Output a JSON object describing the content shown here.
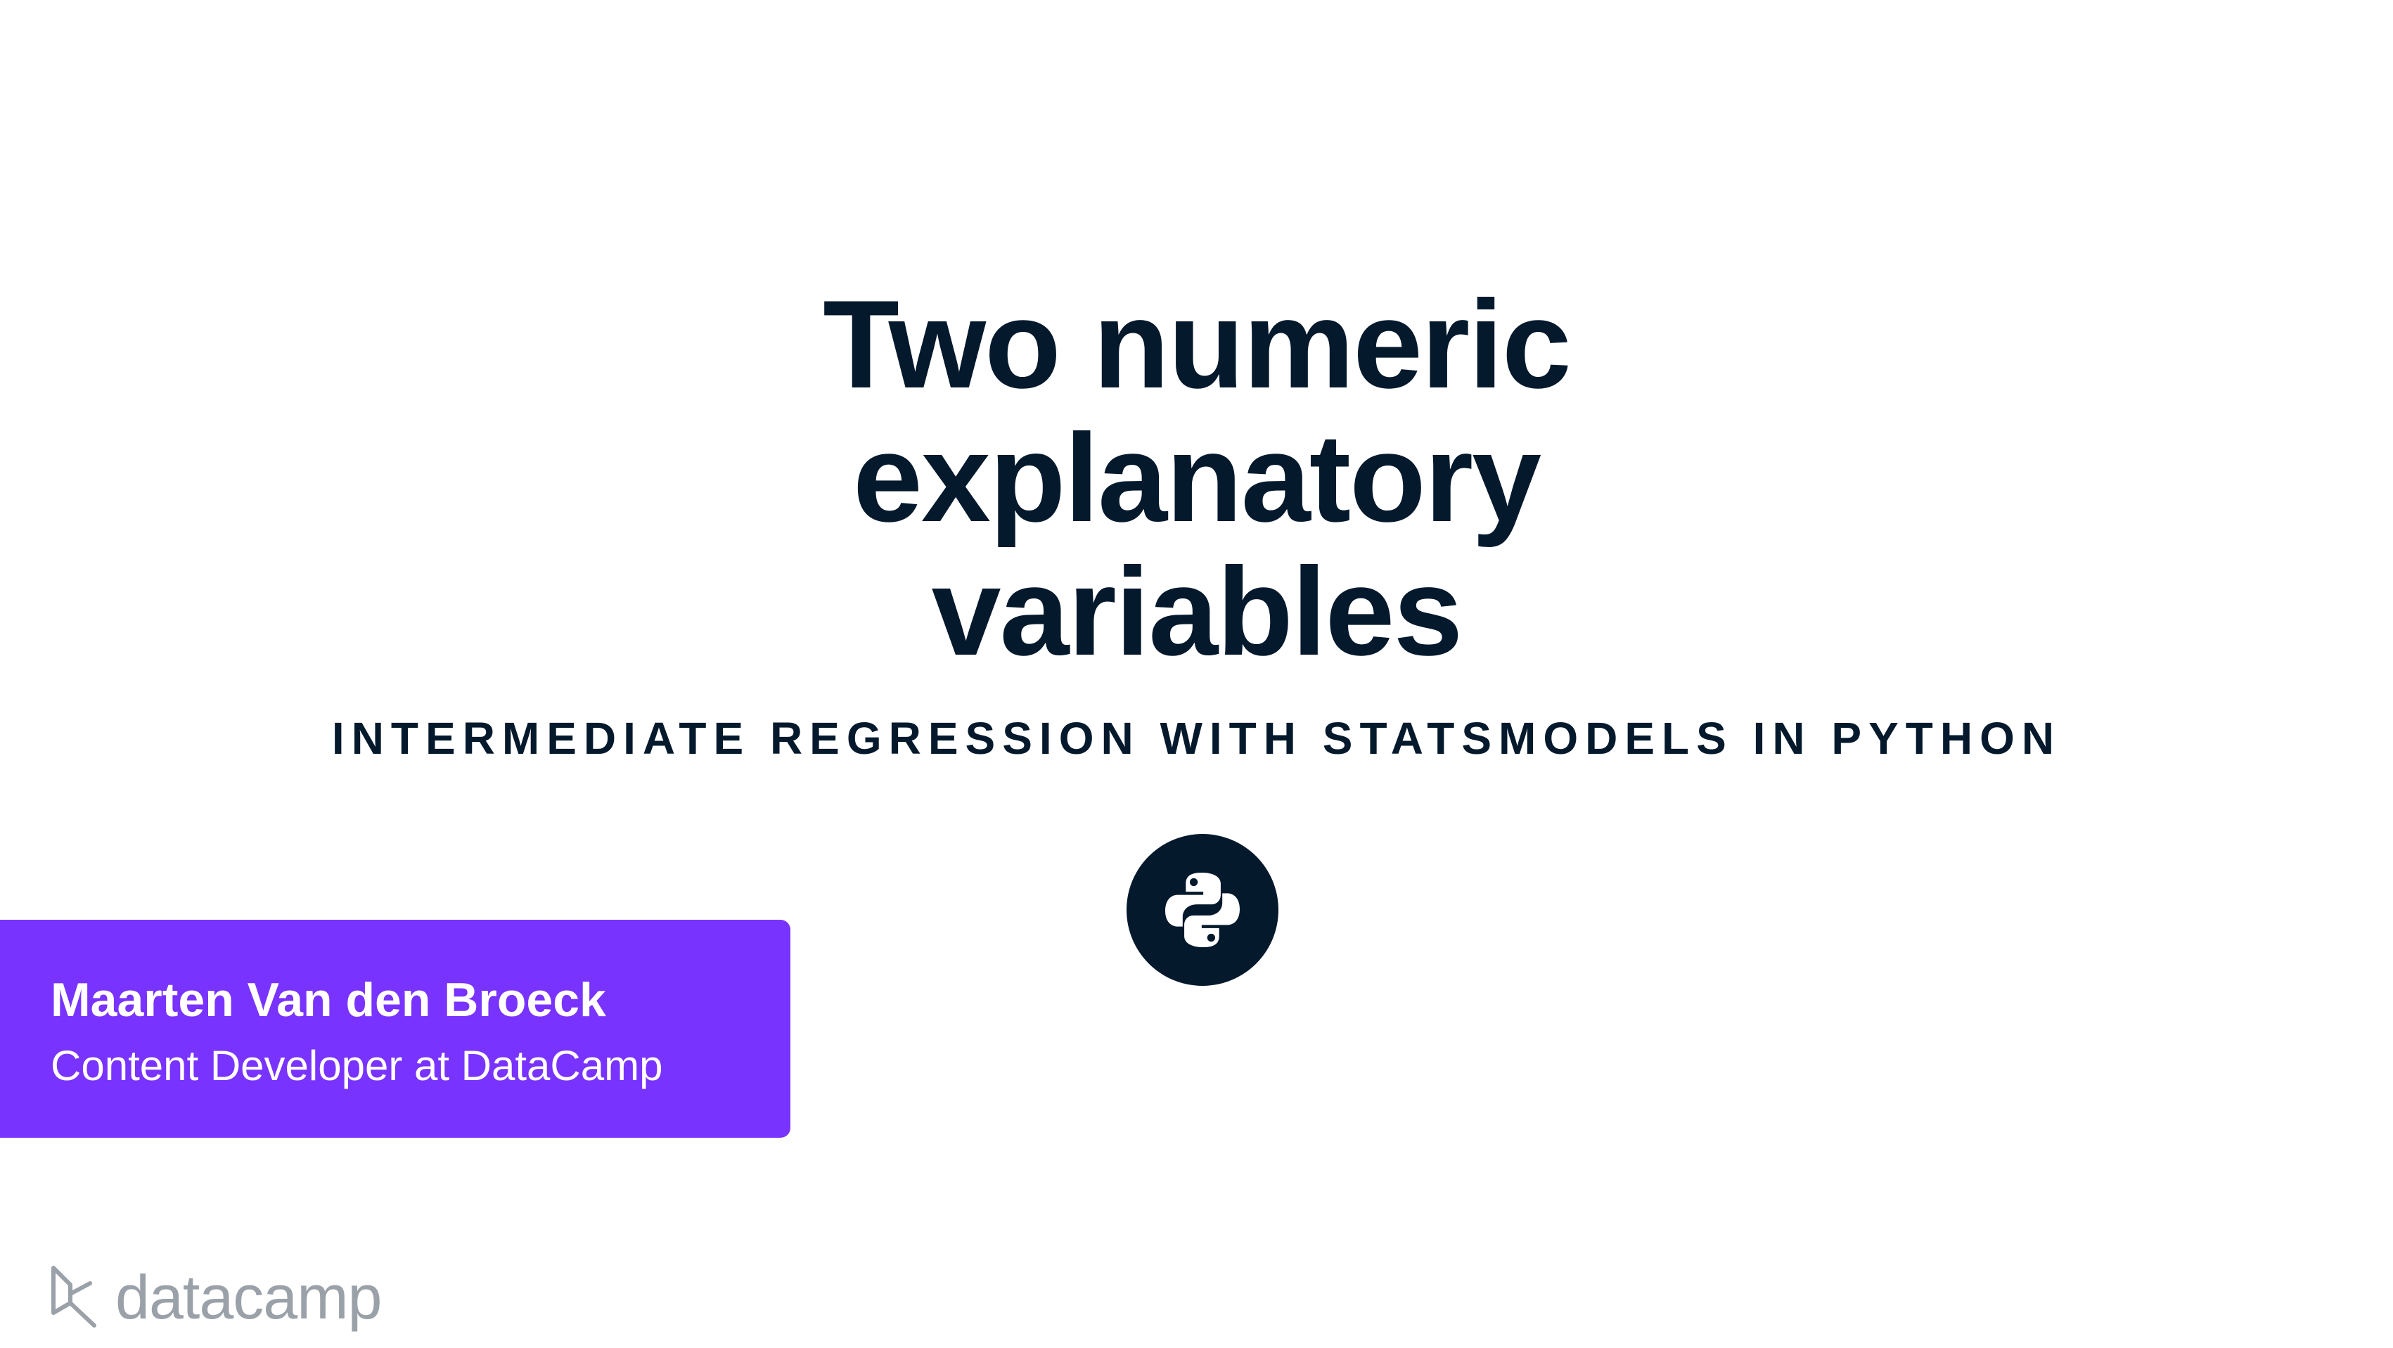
{
  "slide": {
    "title_lines": [
      "Two numeric",
      "explanatory",
      "variables"
    ],
    "course_title": "INTERMEDIATE REGRESSION WITH STATSMODELS IN PYTHON",
    "badge_icon": "python-logo-icon"
  },
  "author": {
    "name": "Maarten Van den Broeck",
    "role": "Content Developer at DataCamp"
  },
  "brand": {
    "logo_icon": "datacamp-logo-icon",
    "name": "datacamp"
  },
  "colors": {
    "navy": "#05192d",
    "purple": "#7933ff",
    "gray": "#9aa1a8",
    "background": "#ffffff"
  }
}
